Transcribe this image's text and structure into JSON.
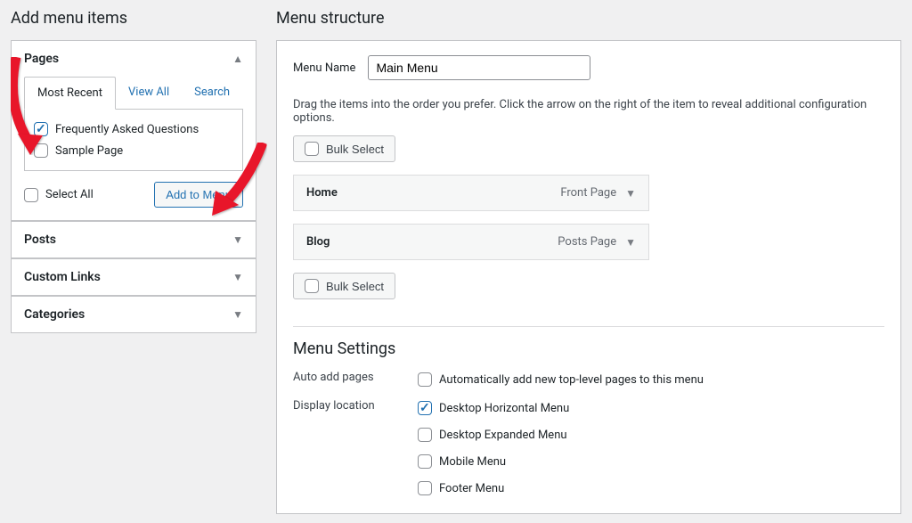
{
  "left": {
    "title": "Add menu items",
    "sections": {
      "pages": "Pages",
      "posts": "Posts",
      "custom_links": "Custom Links",
      "categories": "Categories"
    },
    "tabs": {
      "most_recent": "Most Recent",
      "view_all": "View All",
      "search": "Search"
    },
    "pages_items": {
      "faq": "Frequently Asked Questions",
      "sample": "Sample Page"
    },
    "select_all": "Select All",
    "add_to_menu": "Add to Menu"
  },
  "right": {
    "title": "Menu structure",
    "menu_name_label": "Menu Name",
    "menu_name_value": "Main Menu",
    "instructions": "Drag the items into the order you prefer. Click the arrow on the right of the item to reveal additional configuration options.",
    "bulk_select": "Bulk Select",
    "items": [
      {
        "label": "Home",
        "type": "Front Page"
      },
      {
        "label": "Blog",
        "type": "Posts Page"
      }
    ],
    "settings": {
      "heading": "Menu Settings",
      "auto_add_label": "Auto add pages",
      "auto_add_opt": "Automatically add new top-level pages to this menu",
      "display_loc_label": "Display location",
      "locations": {
        "desktop_h": "Desktop Horizontal Menu",
        "desktop_e": "Desktop Expanded Menu",
        "mobile": "Mobile Menu",
        "footer": "Footer Menu"
      }
    }
  }
}
